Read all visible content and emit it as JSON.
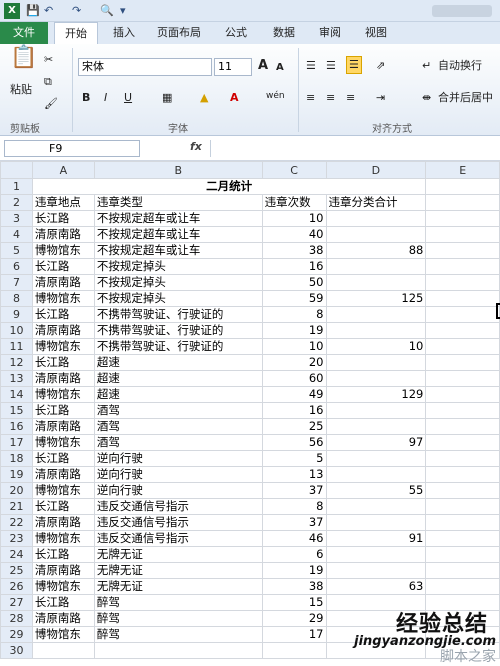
{
  "ribbon_tabs": [
    "文件",
    "开始",
    "插入",
    "页面布局",
    "公式",
    "数据",
    "审阅",
    "视图"
  ],
  "clipboard": {
    "paste": "粘贴",
    "group": "剪贴板"
  },
  "font": {
    "name": "宋体",
    "size": "11",
    "group": "字体",
    "bold": "B",
    "italic": "I",
    "underline": "U",
    "grow": "A",
    "shrink": "A",
    "font_color": "A",
    "phonetic": "wén"
  },
  "alignment": {
    "wrap": "自动换行",
    "merge": "合并后居中",
    "group": "对齐方式"
  },
  "namebox": "F9",
  "fx": "fx",
  "columns": [
    "A",
    "B",
    "C",
    "D",
    "E"
  ],
  "title": "二月统计",
  "headers": [
    "违章地点",
    "违章类型",
    "违章次数",
    "违章分类合计"
  ],
  "rows": [
    [
      "长江路",
      "不按规定超车或让车",
      "10",
      ""
    ],
    [
      "清原南路",
      "不按规定超车或让车",
      "40",
      ""
    ],
    [
      "博物馆东",
      "不按规定超车或让车",
      "38",
      "88"
    ],
    [
      "长江路",
      "不按规定掉头",
      "16",
      ""
    ],
    [
      "清原南路",
      "不按规定掉头",
      "50",
      ""
    ],
    [
      "博物馆东",
      "不按规定掉头",
      "59",
      "125"
    ],
    [
      "长江路",
      "不携带驾驶证、行驶证的",
      "8",
      ""
    ],
    [
      "清原南路",
      "不携带驾驶证、行驶证的",
      "19",
      ""
    ],
    [
      "博物馆东",
      "不携带驾驶证、行驶证的",
      "10",
      "10"
    ],
    [
      "长江路",
      "超速",
      "20",
      ""
    ],
    [
      "清原南路",
      "超速",
      "60",
      ""
    ],
    [
      "博物馆东",
      "超速",
      "49",
      "129"
    ],
    [
      "长江路",
      "酒驾",
      "16",
      ""
    ],
    [
      "清原南路",
      "酒驾",
      "25",
      ""
    ],
    [
      "博物馆东",
      "酒驾",
      "56",
      "97"
    ],
    [
      "长江路",
      "逆向行驶",
      "5",
      ""
    ],
    [
      "清原南路",
      "逆向行驶",
      "13",
      ""
    ],
    [
      "博物馆东",
      "逆向行驶",
      "37",
      "55"
    ],
    [
      "长江路",
      "违反交通信号指示",
      "8",
      ""
    ],
    [
      "清原南路",
      "违反交通信号指示",
      "37",
      ""
    ],
    [
      "博物馆东",
      "违反交通信号指示",
      "46",
      "91"
    ],
    [
      "长江路",
      "无牌无证",
      "6",
      ""
    ],
    [
      "清原南路",
      "无牌无证",
      "19",
      ""
    ],
    [
      "博物馆东",
      "无牌无证",
      "38",
      "63"
    ],
    [
      "长江路",
      "醉驾",
      "15",
      ""
    ],
    [
      "清原南路",
      "醉驾",
      "29",
      ""
    ],
    [
      "博物馆东",
      "醉驾",
      "17",
      ""
    ]
  ],
  "watermark": {
    "logo": "经验总结",
    "url": "jingyanzongjie.com",
    "bg": "脚本之家"
  },
  "colors": {
    "accent": "#2a8a4a",
    "header_bg": "#e4ecf7"
  }
}
